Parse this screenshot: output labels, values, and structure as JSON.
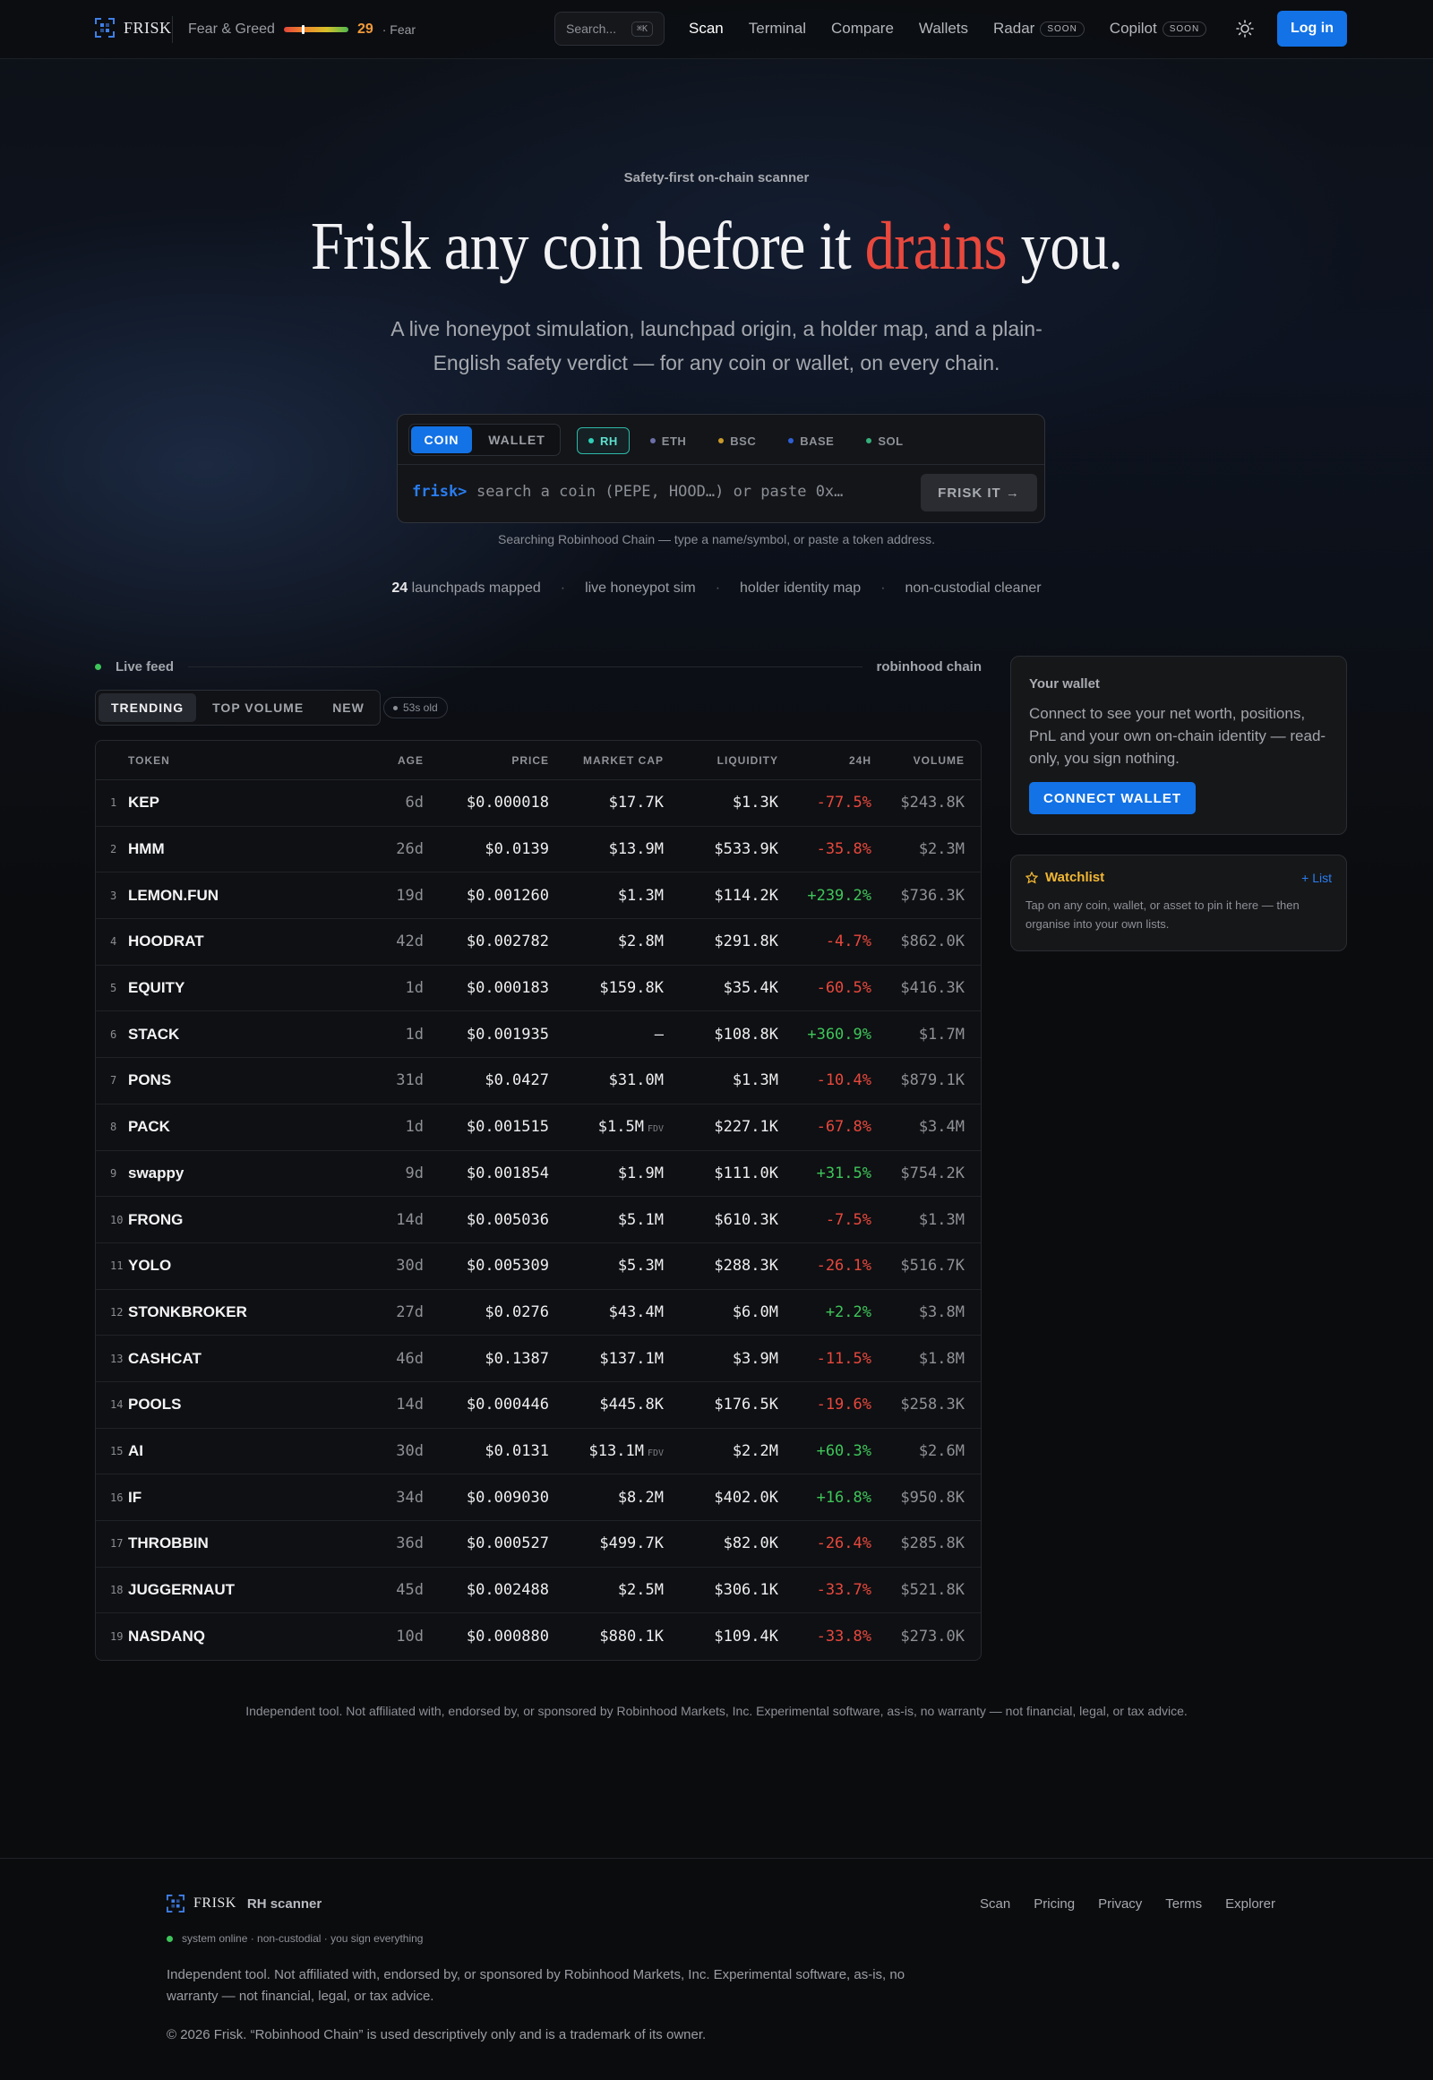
{
  "nav": {
    "logo_text": "FRISK",
    "fear_greed_label": "Fear & Greed",
    "fear_greed_value": "29",
    "fear_greed_state": "· Fear",
    "fear_greed_level": 0.29,
    "search_label": "Search...",
    "search_kbd": "⌘K",
    "links": [
      {
        "label": "Scan"
      },
      {
        "label": "Terminal"
      },
      {
        "label": "Compare"
      },
      {
        "label": "Wallets"
      },
      {
        "label": "Radar",
        "badge": "SOON"
      },
      {
        "label": "Copilot",
        "badge": "SOON"
      }
    ],
    "login_label": "Log in"
  },
  "hero": {
    "eyebrow": "Safety-first on-chain scanner",
    "headline_pre": "Frisk any coin before it ",
    "headline_accent": "drains",
    "headline_post": " you.",
    "subtitle": "A live honeypot simulation, launchpad origin, a holder map, and a plain-English safety verdict — for any coin or wallet, on every chain."
  },
  "search": {
    "modes": [
      "COIN",
      "WALLET"
    ],
    "chains": [
      {
        "label": "RH",
        "color": "#2fd0b9"
      },
      {
        "label": "ETH",
        "color": "#6c70a8"
      },
      {
        "label": "BSC",
        "color": "#c99a2a"
      },
      {
        "label": "BASE",
        "color": "#2f5fd6"
      },
      {
        "label": "SOL",
        "color": "#36b07a"
      }
    ],
    "prompt": "frisk>",
    "placeholder": "search a coin (PEPE, HOOD…) or paste 0x…",
    "button": "FRISK IT →",
    "hint": "Searching Robinhood Chain — type a name/symbol, or paste a token address."
  },
  "features": {
    "count": "24",
    "count_label": "launchpads mapped",
    "items": [
      "live honeypot sim",
      "holder identity map",
      "non-custodial cleaner"
    ],
    "separator": "·"
  },
  "feed": {
    "label": "Live feed",
    "chain": "robinhood chain",
    "tabs": [
      "TRENDING",
      "TOP VOLUME",
      "NEW"
    ],
    "age": "53s old",
    "columns": [
      "TOKEN",
      "AGE",
      "PRICE",
      "MARKET CAP",
      "LIQUIDITY",
      "24H",
      "VOLUME"
    ],
    "rows": [
      {
        "rank": "1",
        "token": "KEP",
        "age": "6d",
        "price": "$0.000018",
        "mcap": "$17.7K",
        "fdv": "",
        "liq": "$1.3K",
        "change": "-77.5%",
        "volume": "$243.8K"
      },
      {
        "rank": "2",
        "token": "HMM",
        "age": "26d",
        "price": "$0.0139",
        "mcap": "$13.9M",
        "fdv": "",
        "liq": "$533.9K",
        "change": "-35.8%",
        "volume": "$2.3M"
      },
      {
        "rank": "3",
        "token": "LEMON.FUN",
        "age": "19d",
        "price": "$0.001260",
        "mcap": "$1.3M",
        "fdv": "",
        "liq": "$114.2K",
        "change": "+239.2%",
        "volume": "$736.3K"
      },
      {
        "rank": "4",
        "token": "HOODRAT",
        "age": "42d",
        "price": "$0.002782",
        "mcap": "$2.8M",
        "fdv": "",
        "liq": "$291.8K",
        "change": "-4.7%",
        "volume": "$862.0K"
      },
      {
        "rank": "5",
        "token": "EQUITY",
        "age": "1d",
        "price": "$0.000183",
        "mcap": "$159.8K",
        "fdv": "",
        "liq": "$35.4K",
        "change": "-60.5%",
        "volume": "$416.3K"
      },
      {
        "rank": "6",
        "token": "STACK",
        "age": "1d",
        "price": "$0.001935",
        "mcap": "—",
        "fdv": "",
        "liq": "$108.8K",
        "change": "+360.9%",
        "volume": "$1.7M"
      },
      {
        "rank": "7",
        "token": "PONS",
        "age": "31d",
        "price": "$0.0427",
        "mcap": "$31.0M",
        "fdv": "",
        "liq": "$1.3M",
        "change": "-10.4%",
        "volume": "$879.1K"
      },
      {
        "rank": "8",
        "token": "PACK",
        "age": "1d",
        "price": "$0.001515",
        "mcap": "$1.5M",
        "fdv": "FDV",
        "liq": "$227.1K",
        "change": "-67.8%",
        "volume": "$3.4M"
      },
      {
        "rank": "9",
        "token": "swappy",
        "age": "9d",
        "price": "$0.001854",
        "mcap": "$1.9M",
        "fdv": "",
        "liq": "$111.0K",
        "change": "+31.5%",
        "volume": "$754.2K"
      },
      {
        "rank": "10",
        "token": "FRONG",
        "age": "14d",
        "price": "$0.005036",
        "mcap": "$5.1M",
        "fdv": "",
        "liq": "$610.3K",
        "change": "-7.5%",
        "volume": "$1.3M"
      },
      {
        "rank": "11",
        "token": "YOLO",
        "age": "30d",
        "price": "$0.005309",
        "mcap": "$5.3M",
        "fdv": "",
        "liq": "$288.3K",
        "change": "-26.1%",
        "volume": "$516.7K"
      },
      {
        "rank": "12",
        "token": "STONKBROKER",
        "age": "27d",
        "price": "$0.0276",
        "mcap": "$43.4M",
        "fdv": "",
        "liq": "$6.0M",
        "change": "+2.2%",
        "volume": "$3.8M"
      },
      {
        "rank": "13",
        "token": "CASHCAT",
        "age": "46d",
        "price": "$0.1387",
        "mcap": "$137.1M",
        "fdv": "",
        "liq": "$3.9M",
        "change": "-11.5%",
        "volume": "$1.8M"
      },
      {
        "rank": "14",
        "token": "POOLS",
        "age": "14d",
        "price": "$0.000446",
        "mcap": "$445.8K",
        "fdv": "",
        "liq": "$176.5K",
        "change": "-19.6%",
        "volume": "$258.3K"
      },
      {
        "rank": "15",
        "token": "AI",
        "age": "30d",
        "price": "$0.0131",
        "mcap": "$13.1M",
        "fdv": "FDV",
        "liq": "$2.2M",
        "change": "+60.3%",
        "volume": "$2.6M"
      },
      {
        "rank": "16",
        "token": "IF",
        "age": "34d",
        "price": "$0.009030",
        "mcap": "$8.2M",
        "fdv": "",
        "liq": "$402.0K",
        "change": "+16.8%",
        "volume": "$950.8K"
      },
      {
        "rank": "17",
        "token": "THROBBIN",
        "age": "36d",
        "price": "$0.000527",
        "mcap": "$499.7K",
        "fdv": "",
        "liq": "$82.0K",
        "change": "-26.4%",
        "volume": "$285.8K"
      },
      {
        "rank": "18",
        "token": "JUGGERNAUT",
        "age": "45d",
        "price": "$0.002488",
        "mcap": "$2.5M",
        "fdv": "",
        "liq": "$306.1K",
        "change": "-33.7%",
        "volume": "$521.8K"
      },
      {
        "rank": "19",
        "token": "NASDANQ",
        "age": "10d",
        "price": "$0.000880",
        "mcap": "$880.1K",
        "fdv": "",
        "liq": "$109.4K",
        "change": "-33.8%",
        "volume": "$273.0K"
      }
    ]
  },
  "wallet_card": {
    "title": "Your wallet",
    "desc": "Connect to see your net worth, positions, PnL and your own on-chain identity — read-only, you sign nothing.",
    "button": "CONNECT WALLET"
  },
  "watchlist": {
    "title": "Watchlist",
    "add": "+ List",
    "desc": "Tap on any coin, wallet, or asset to pin it here — then organise into your own lists."
  },
  "disclaimer": "Independent tool. Not affiliated with, endorsed by, or sponsored by Robinhood Markets, Inc. Experimental software, as-is, no warranty — not financial, legal, or tax advice.",
  "footer": {
    "logo_text": "FRISK",
    "product": "RH scanner",
    "links": [
      "Scan",
      "Pricing",
      "Privacy",
      "Terms",
      "Explorer"
    ],
    "status": "system online · non-custodial · you sign everything",
    "text": "Independent tool. Not affiliated with, endorsed by, or sponsored by Robinhood Markets, Inc. Experimental software, as-is, no warranty — not financial, legal, or tax advice.",
    "copyright": "© 2026 Frisk. “Robinhood Chain” is used descriptively only and is a trademark of its owner."
  }
}
